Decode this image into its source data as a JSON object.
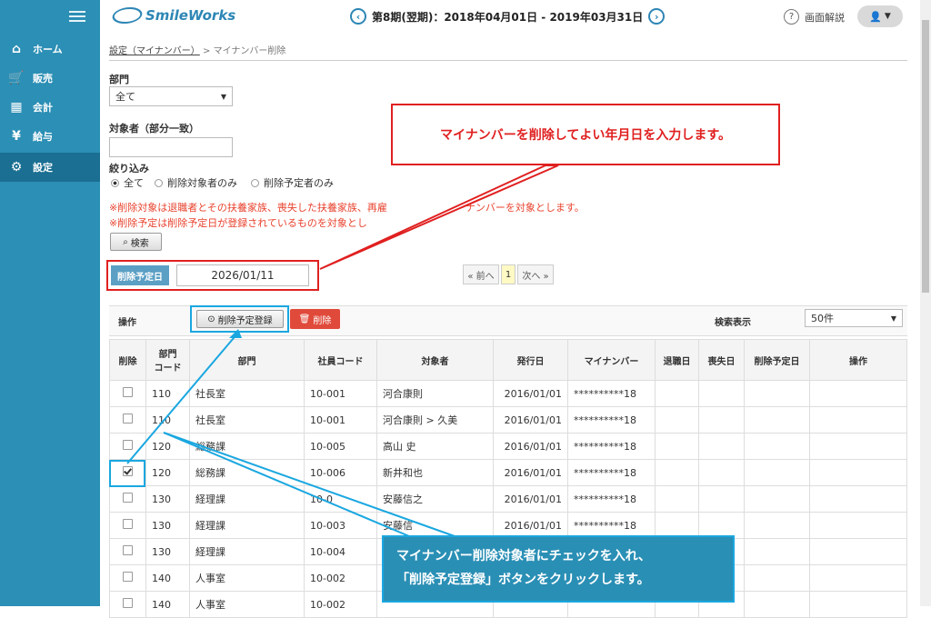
{
  "sidebar": {
    "items": [
      {
        "label": "ホーム",
        "icon": "home-icon"
      },
      {
        "label": "販売",
        "icon": "cart-icon"
      },
      {
        "label": "会計",
        "icon": "calculator-icon"
      },
      {
        "label": "給与",
        "icon": "yen-icon"
      },
      {
        "label": "設定",
        "icon": "gear-icon"
      }
    ],
    "active_color": "#1a6f92"
  },
  "header": {
    "logo": "SmileWorks",
    "period": "第8期(翌期)：2018年04月01日 - 2019年03月31日",
    "help_label": "画面解説"
  },
  "breadcrumb": {
    "parent": "設定（マイナンバー）",
    "sep": ">",
    "current": "マイナンバー削除"
  },
  "filters": {
    "dept_label": "部門",
    "dept_value": "全て",
    "target_label": "対象者（部分一致）",
    "narrow_label": "絞り込み",
    "radios": [
      "全て",
      "削除対象者のみ",
      "削除予定者のみ"
    ],
    "note1": "※削除対象は退職者とその扶養家族、喪失した扶養家族、再雇",
    "note1_tail": "ナンバーを対象とします。",
    "note2": "※削除予定は削除予定日が登録されているものを対象とし",
    "search_button": "検索"
  },
  "deletion_date": {
    "label": "削除予定日",
    "value": "2026/01/11"
  },
  "pager": {
    "prev": "« 前へ",
    "current": "1",
    "next": "次へ »"
  },
  "operations": {
    "label": "操作",
    "register_button": "削除予定登録",
    "delete_button": "削除",
    "display_label": "検索表示",
    "display_value": "50件"
  },
  "table": {
    "headers": [
      "削除",
      "部門\nコード",
      "部門",
      "社員コード",
      "対象者",
      "発行日",
      "マイナンバー",
      "退職日",
      "喪失日",
      "削除予定日",
      "操作"
    ],
    "rows": [
      {
        "checked": false,
        "dept_code": "110",
        "dept": "社長室",
        "emp_code": "10-001",
        "name": "河合康則",
        "issued": "2016/01/01",
        "mynumber": "**********18"
      },
      {
        "checked": false,
        "dept_code": "110",
        "dept": "社長室",
        "emp_code": "10-001",
        "name": "河合康則 > 久美",
        "issued": "2016/01/01",
        "mynumber": "**********18"
      },
      {
        "checked": false,
        "dept_code": "120",
        "dept": "総務課",
        "emp_code": "10-005",
        "name": "高山 史",
        "issued": "2016/01/01",
        "mynumber": "**********18"
      },
      {
        "checked": true,
        "dept_code": "120",
        "dept": "総務課",
        "emp_code": "10-006",
        "name": "新井和也",
        "issued": "2016/01/01",
        "mynumber": "**********18"
      },
      {
        "checked": false,
        "dept_code": "130",
        "dept": "経理課",
        "emp_code": "10-0",
        "name": "安藤信之",
        "issued": "2016/01/01",
        "mynumber": "**********18"
      },
      {
        "checked": false,
        "dept_code": "130",
        "dept": "経理課",
        "emp_code": "10-003",
        "name": "安藤信",
        "issued": "2016/01/01",
        "mynumber": "**********18"
      },
      {
        "checked": false,
        "dept_code": "130",
        "dept": "経理課",
        "emp_code": "10-004",
        "name": "",
        "issued": "",
        "mynumber": ""
      },
      {
        "checked": false,
        "dept_code": "140",
        "dept": "人事室",
        "emp_code": "10-002",
        "name": "",
        "issued": "",
        "mynumber": ""
      },
      {
        "checked": false,
        "dept_code": "140",
        "dept": "人事室",
        "emp_code": "10-002",
        "name": "",
        "issued": "",
        "mynumber": ""
      }
    ]
  },
  "annotations": {
    "red": "マイナンバーを削除してよい年月日を入力します。",
    "blue_line1": "マイナンバー削除対象者にチェックを入れ、",
    "blue_line2": "「削除予定登録」ボタンをクリックします。"
  }
}
